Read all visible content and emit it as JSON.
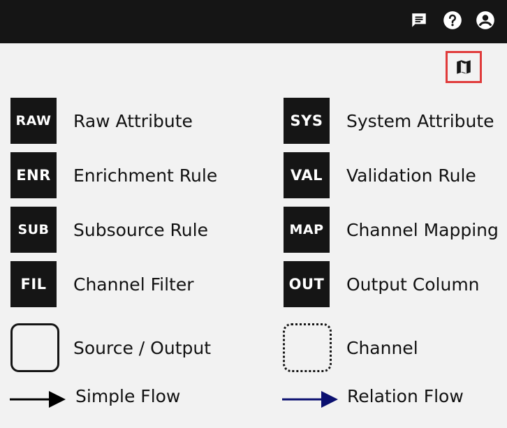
{
  "header": {
    "icons": [
      "chat-icon",
      "help-icon",
      "account-icon"
    ]
  },
  "toolbar": {
    "map_toggle_icon": "map-icon",
    "highlight_color": "#e03b3b"
  },
  "legend": {
    "left": [
      {
        "abbr": "RAW",
        "label": "Raw Attribute"
      },
      {
        "abbr": "ENR",
        "label": "Enrichment Rule"
      },
      {
        "abbr": "SUB",
        "label": "Subsource Rule"
      },
      {
        "abbr": "FIL",
        "label": "Channel Filter"
      }
    ],
    "right": [
      {
        "abbr": "SYS",
        "label": "System Attribute"
      },
      {
        "abbr": "VAL",
        "label": "Validation Rule"
      },
      {
        "abbr": "MAP",
        "label": "Channel Mapping"
      },
      {
        "abbr": "OUT",
        "label": "Output Column"
      }
    ],
    "shapes": {
      "source_output": "Source / Output",
      "channel": "Channel"
    },
    "flows": {
      "simple": {
        "label": "Simple Flow",
        "color": "#000000"
      },
      "relation": {
        "label": "Relation Flow",
        "color": "#0b1070"
      }
    }
  }
}
